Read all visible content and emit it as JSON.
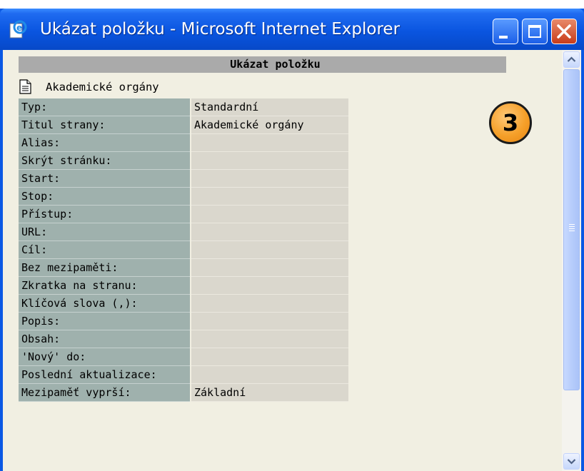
{
  "window": {
    "title": "Ukázat položku - Microsoft Internet Explorer"
  },
  "page": {
    "header": "Ukázat položku",
    "item_name": "Akademické orgány",
    "badge_number": "3"
  },
  "properties": [
    {
      "label": "Typ:",
      "value": "Standardní"
    },
    {
      "label": "Titul strany:",
      "value": "Akademické orgány"
    },
    {
      "label": "Alias:",
      "value": ""
    },
    {
      "label": "Skrýt stránku:",
      "value": ""
    },
    {
      "label": "Start:",
      "value": ""
    },
    {
      "label": "Stop:",
      "value": ""
    },
    {
      "label": "Přístup:",
      "value": ""
    },
    {
      "label": "URL:",
      "value": ""
    },
    {
      "label": "Cíl:",
      "value": ""
    },
    {
      "label": "Bez mezipaměti:",
      "value": ""
    },
    {
      "label": "Zkratka na stranu:",
      "value": ""
    },
    {
      "label": "Klíčová slova (,):",
      "value": ""
    },
    {
      "label": "Popis:",
      "value": ""
    },
    {
      "label": "Obsah:",
      "value": ""
    },
    {
      "label": "'Nový' do:",
      "value": ""
    },
    {
      "label": "Poslední aktualizace:",
      "value": ""
    },
    {
      "label": "Mezipaměť vyprší:",
      "value": "Základní"
    }
  ],
  "icons": {
    "app": "ie-page-icon",
    "item": "document-icon",
    "minimize": "minimize-icon",
    "maximize": "maximize-icon",
    "close": "close-icon",
    "scroll_up": "chevron-up-icon",
    "scroll_down": "chevron-down-icon"
  },
  "colors": {
    "titlebar": "#0a55e0",
    "background": "#f1efe2",
    "label_cell": "#9fb1ad",
    "value_cell": "#dad7cd",
    "header_bar": "#aaaaaa",
    "badge": "#f5a02a",
    "close_button": "#c83c1a"
  }
}
